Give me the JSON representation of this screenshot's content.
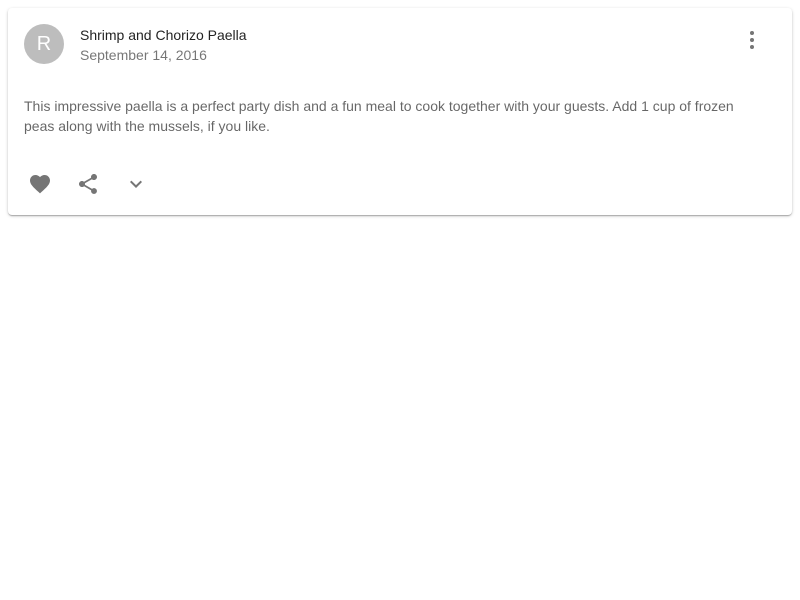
{
  "card": {
    "avatar_letter": "R",
    "title": "Shrimp and Chorizo Paella",
    "subheader": "September 14, 2016",
    "body": "This impressive paella is a perfect party dish and a fun meal to cook together with your guests. Add 1 cup of frozen peas along with the mussels, if you like.",
    "icons": {
      "menu": "more-vert-icon",
      "favorite": "heart-icon",
      "share": "share-icon",
      "expand": "chevron-down-icon"
    },
    "colors": {
      "avatar_bg": "#bdbdbd",
      "icon": "#757575"
    }
  }
}
